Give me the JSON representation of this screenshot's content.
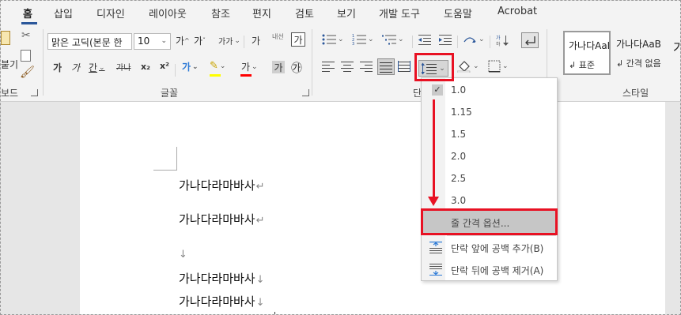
{
  "tabs": [
    "홈",
    "삽입",
    "디자인",
    "레이아웃",
    "참조",
    "편지",
    "검토",
    "보기",
    "개발 도구",
    "도움말",
    "Acrobat"
  ],
  "clipboard": {
    "paste_label": "붙여넣기",
    "paste_label_visible": "붙기",
    "group_label": "보드"
  },
  "font": {
    "name": "맑은 고딕(본문 한",
    "size": "10",
    "grow": "가",
    "shrink": "가",
    "change_case": "가가",
    "phonetic": "가",
    "clear_format": "내선",
    "char_border": "가",
    "bold": "가",
    "italic": "가",
    "underline": "간",
    "strike": "가나",
    "subscript": "x₂",
    "superscript": "x²",
    "text_effects": "가",
    "font_color": "가",
    "char_shading": "가",
    "enclosed": "㉮",
    "group_label": "글꼴"
  },
  "paragraph": {
    "group_label": "단락",
    "group_label_visible": "단"
  },
  "styles": {
    "group_label": "스타일",
    "items": [
      {
        "preview": "가나다AaB",
        "name": "↲ 표준"
      },
      {
        "preview": "가나다AaB",
        "name": "↲ 간격 없음"
      },
      {
        "preview": "가",
        "name": ""
      }
    ]
  },
  "line_spacing_menu": {
    "options": [
      "1.0",
      "1.15",
      "1.5",
      "2.0",
      "2.5",
      "3.0"
    ],
    "checked_index": 0,
    "options_item": "줄 간격 옵션...",
    "add_space_before": "단락 앞에 공백 추가(B)",
    "remove_space_after": "단락 뒤에 공백 제거(A)"
  },
  "document": {
    "lines": [
      {
        "text": "가나다라마바사",
        "mark": "↵"
      },
      {
        "text": "가나다라마바사",
        "mark": "↵"
      },
      {
        "text": "",
        "mark": "↓"
      },
      {
        "text": "가나다라마바사",
        "mark": "↓"
      },
      {
        "text": "가나다라마바사",
        "mark": "↓"
      }
    ]
  },
  "colors": {
    "accent": "#2b579a",
    "annotation": "#e81123",
    "highlight": "#ffff00",
    "font_color": "#ff0000"
  }
}
